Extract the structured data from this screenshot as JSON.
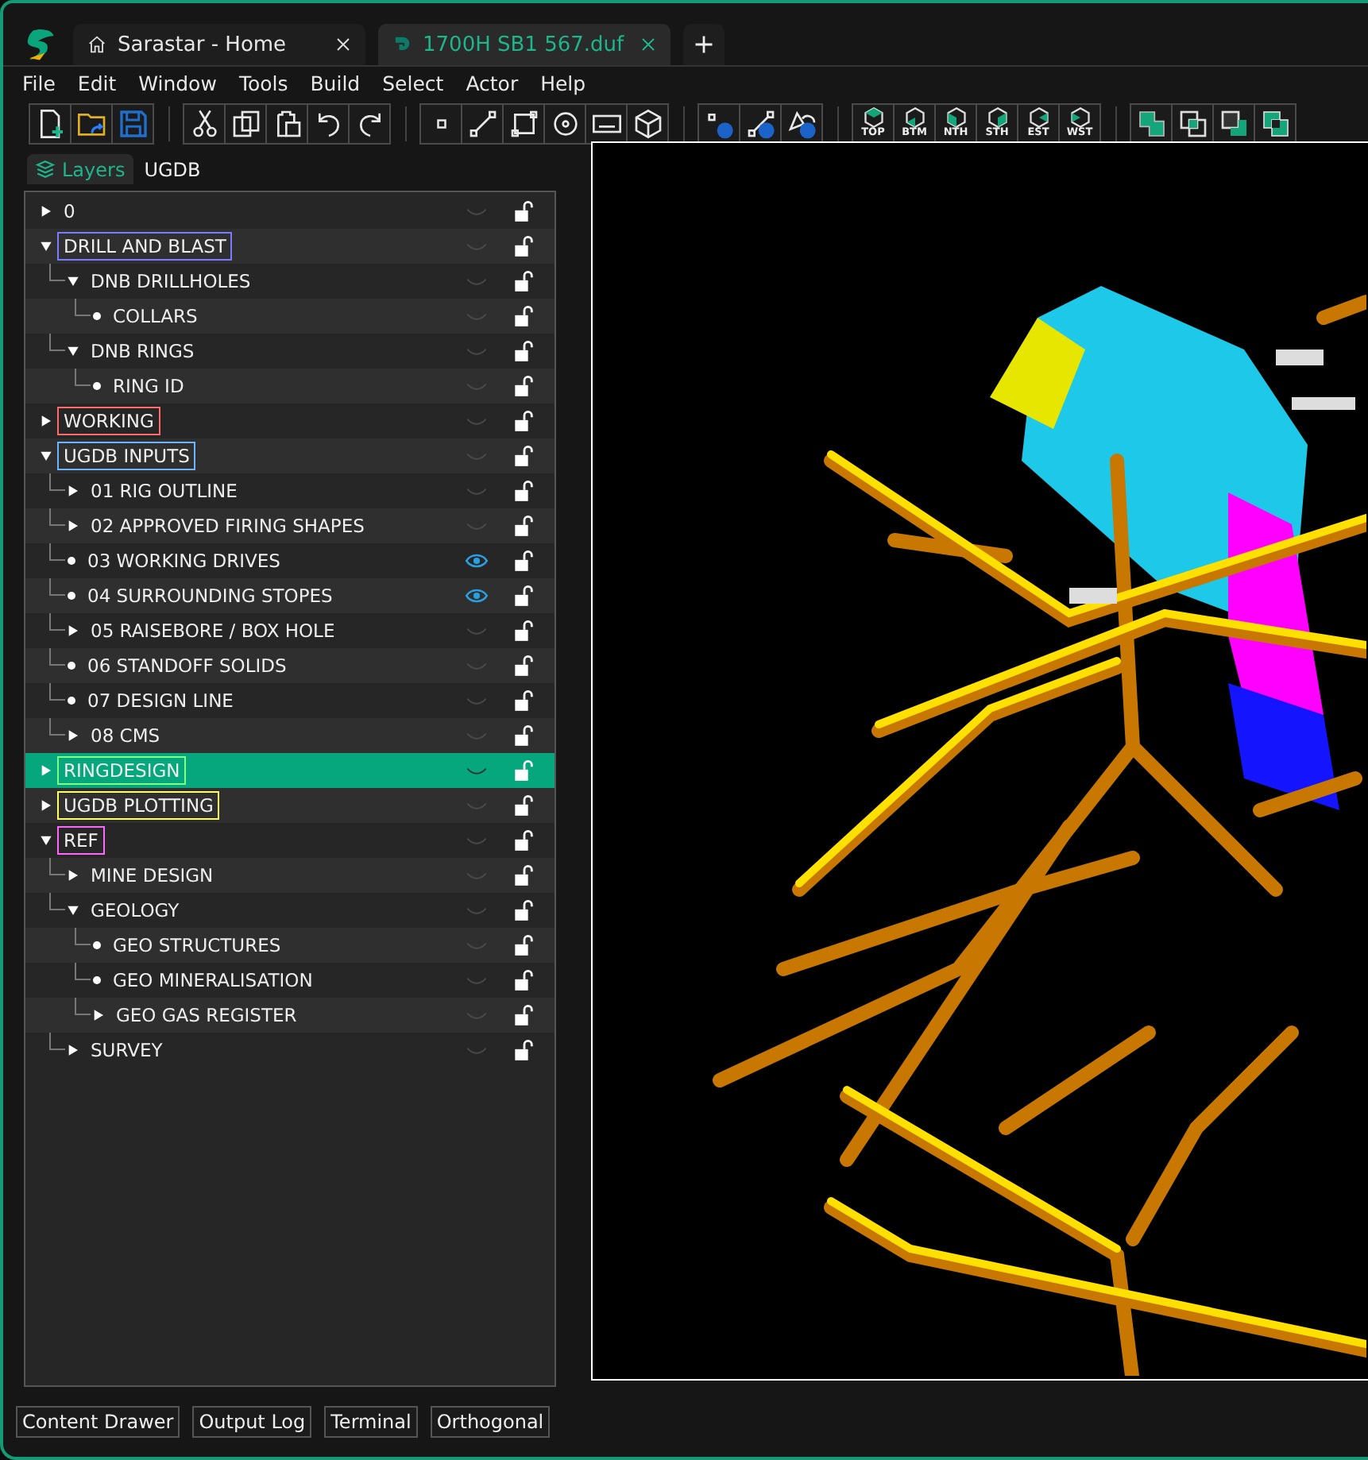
{
  "tabs": [
    {
      "label": "Sarastar - Home",
      "kind": "home",
      "selected": false
    },
    {
      "label": "1700H SB1 567.duf",
      "kind": "file",
      "selected": true
    }
  ],
  "menu": [
    "File",
    "Edit",
    "Window",
    "Tools",
    "Build",
    "Select",
    "Actor",
    "Help"
  ],
  "view_buttons": [
    "TOP",
    "BTM",
    "NTH",
    "STH",
    "EST",
    "WST"
  ],
  "panel_tabs": [
    {
      "label": "Layers",
      "selected": true
    },
    {
      "label": "UGDB",
      "selected": false
    }
  ],
  "layers": [
    {
      "name": "0",
      "kind": "group",
      "expanded": false,
      "visible": false,
      "selected": false
    },
    {
      "name": "DRILL AND BLAST",
      "kind": "group",
      "expanded": true,
      "visible": false,
      "selected": false,
      "color": "#7b7bff",
      "children": [
        {
          "name": "DNB DRILLHOLES",
          "kind": "group",
          "expanded": true,
          "visible": false,
          "selected": false,
          "children": [
            {
              "name": "COLLARS",
              "kind": "layer",
              "visible": false,
              "selected": false
            }
          ]
        },
        {
          "name": "DNB RINGS",
          "kind": "group",
          "expanded": true,
          "visible": false,
          "selected": false,
          "children": [
            {
              "name": "RING ID",
              "kind": "layer",
              "visible": false,
              "selected": false
            }
          ]
        }
      ]
    },
    {
      "name": "WORKING",
      "kind": "group",
      "expanded": false,
      "visible": false,
      "selected": false,
      "color": "#ff6b6b"
    },
    {
      "name": "UGDB INPUTS",
      "kind": "group",
      "expanded": true,
      "visible": false,
      "selected": false,
      "color": "#6cb4ff",
      "children": [
        {
          "name": "01 RIG OUTLINE",
          "kind": "group",
          "expanded": false,
          "visible": false,
          "selected": false
        },
        {
          "name": "02 APPROVED FIRING SHAPES",
          "kind": "group",
          "expanded": false,
          "visible": false,
          "selected": false
        },
        {
          "name": "03 WORKING DRIVES",
          "kind": "layer",
          "visible": true,
          "selected": false
        },
        {
          "name": "04 SURROUNDING STOPES",
          "kind": "layer",
          "visible": true,
          "selected": false
        },
        {
          "name": "05 RAISEBORE / BOX HOLE",
          "kind": "group",
          "expanded": false,
          "visible": false,
          "selected": false
        },
        {
          "name": "06 STANDOFF SOLIDS",
          "kind": "layer",
          "visible": false,
          "selected": false
        },
        {
          "name": "07 DESIGN LINE",
          "kind": "layer",
          "visible": false,
          "selected": false
        },
        {
          "name": "08 CMS",
          "kind": "group",
          "expanded": false,
          "visible": false,
          "selected": false
        }
      ]
    },
    {
      "name": "RINGDESIGN",
      "kind": "group",
      "expanded": false,
      "visible": false,
      "selected": true,
      "color": "#80ff80"
    },
    {
      "name": "UGDB PLOTTING",
      "kind": "group",
      "expanded": false,
      "visible": false,
      "selected": false,
      "color": "#ffff66"
    },
    {
      "name": "REF",
      "kind": "group",
      "expanded": true,
      "visible": false,
      "selected": false,
      "color": "#ff66ff",
      "children": [
        {
          "name": "MINE DESIGN",
          "kind": "group",
          "expanded": false,
          "visible": false,
          "selected": false
        },
        {
          "name": "GEOLOGY",
          "kind": "group",
          "expanded": true,
          "visible": false,
          "selected": false,
          "children": [
            {
              "name": "GEO STRUCTURES",
              "kind": "layer",
              "visible": false,
              "selected": false
            },
            {
              "name": "GEO MINERALISATION",
              "kind": "layer",
              "visible": false,
              "selected": false
            },
            {
              "name": "GEO GAS REGISTER",
              "kind": "group",
              "expanded": false,
              "visible": false,
              "selected": false
            }
          ]
        },
        {
          "name": "SURVEY",
          "kind": "group",
          "expanded": false,
          "visible": false,
          "selected": false
        }
      ]
    }
  ],
  "bottom_buttons": [
    "Content Drawer",
    "Output Log",
    "Terminal",
    "Orthogonal"
  ]
}
